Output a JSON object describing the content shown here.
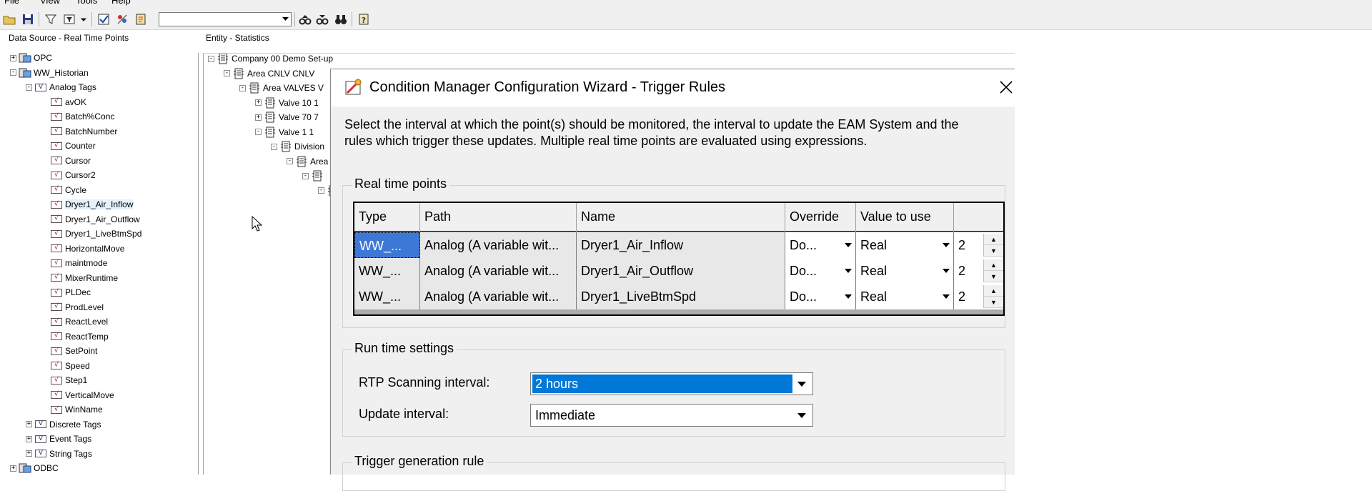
{
  "menubar": {
    "items": [
      "File",
      "View",
      "Tools",
      "Help"
    ]
  },
  "toolbar": {
    "icons": [
      "open-folder-icon",
      "save-icon",
      "filter-icon",
      "filter-options-icon",
      "dropdown-arrow-icon",
      "checkmark-icon",
      "points-icon",
      "settings-icon",
      "find-previous-icon",
      "find-next-icon",
      "binoculars-icon",
      "help-icon"
    ],
    "combo_value": ""
  },
  "left_panel": {
    "header": "Data Source - Real Time Points",
    "tree": [
      {
        "label": "OPC",
        "level": 0,
        "exp": "+"
      },
      {
        "label": "WW_Historian",
        "level": 0,
        "exp": "-"
      },
      {
        "label": "Analog Tags",
        "level": 1,
        "exp": "-"
      },
      {
        "label": "avOK",
        "level": 2
      },
      {
        "label": "Batch%Conc",
        "level": 2
      },
      {
        "label": "BatchNumber",
        "level": 2
      },
      {
        "label": "Counter",
        "level": 2
      },
      {
        "label": "Cursor",
        "level": 2
      },
      {
        "label": "Cursor2",
        "level": 2
      },
      {
        "label": "Cycle",
        "level": 2
      },
      {
        "label": "Dryer1_Air_Inflow",
        "level": 2,
        "selected": true
      },
      {
        "label": "Dryer1_Air_Outflow",
        "level": 2
      },
      {
        "label": "Dryer1_LiveBtmSpd",
        "level": 2
      },
      {
        "label": "HorizontalMove",
        "level": 2
      },
      {
        "label": "maintmode",
        "level": 2
      },
      {
        "label": "MixerRuntime",
        "level": 2
      },
      {
        "label": "PLDec",
        "level": 2
      },
      {
        "label": "ProdLevel",
        "level": 2
      },
      {
        "label": "ReactLevel",
        "level": 2
      },
      {
        "label": "ReactTemp",
        "level": 2
      },
      {
        "label": "SetPoint",
        "level": 2
      },
      {
        "label": "Speed",
        "level": 2
      },
      {
        "label": "Step1",
        "level": 2
      },
      {
        "label": "VerticalMove",
        "level": 2
      },
      {
        "label": "WinName",
        "level": 2
      },
      {
        "label": "Discrete Tags",
        "level": 1,
        "exp": "+"
      },
      {
        "label": "Event Tags",
        "level": 1,
        "exp": "+"
      },
      {
        "label": "String Tags",
        "level": 1,
        "exp": "+"
      },
      {
        "label": "ODBC",
        "level": 0,
        "exp": "+"
      }
    ]
  },
  "right_panel": {
    "header": "Entity - Statistics",
    "tree": [
      {
        "label": "Company  00  Demo Set-up",
        "level": 0,
        "exp": "-"
      },
      {
        "label": "Area  CNLV  CNLV",
        "level": 1,
        "exp": "-"
      },
      {
        "label": "Area  VALVES  V",
        "level": 2,
        "exp": "-"
      },
      {
        "label": "Valve  10  1",
        "level": 3,
        "exp": "+"
      },
      {
        "label": "Valve  70  7",
        "level": 3,
        "exp": "+"
      },
      {
        "label": "Valve  1  1",
        "level": 3,
        "exp": "-"
      },
      {
        "label": "Division",
        "level": 4,
        "exp": "-"
      },
      {
        "label": "Area",
        "level": 5,
        "exp": "-"
      },
      {
        "label": "",
        "level": 6,
        "exp": "-"
      },
      {
        "label": "",
        "level": 7,
        "exp": "-"
      }
    ]
  },
  "dialog": {
    "title": "Condition Manager Configuration Wizard - Trigger Rules",
    "description": "Select the interval at which the point(s) should be monitored, the interval to update the EAM System and the rules which trigger these updates. Multiple real time points are evaluated using expressions.",
    "rtp_group": "Real time points",
    "columns": [
      "Type",
      "Path",
      "Name",
      "Override",
      "Value to use",
      ""
    ],
    "rows": [
      {
        "type": "WW_...",
        "path": "Analog (A variable wit...",
        "name": "Dryer1_Air_Inflow",
        "override": "Do...",
        "value": "Real",
        "num": "2"
      },
      {
        "type": "WW_...",
        "path": "Analog (A variable wit...",
        "name": "Dryer1_Air_Outflow",
        "override": "Do...",
        "value": "Real",
        "num": "2"
      },
      {
        "type": "WW_...",
        "path": "Analog (A variable wit...",
        "name": "Dryer1_LiveBtmSpd",
        "override": "Do...",
        "value": "Real",
        "num": "2"
      }
    ],
    "runtime_group": "Run time settings",
    "rtp_scan_label": "RTP Scanning interval:",
    "rtp_scan_value": "2 hours",
    "update_label": "Update interval:",
    "update_value": "Immediate",
    "trigger_group": "Trigger generation rule"
  }
}
